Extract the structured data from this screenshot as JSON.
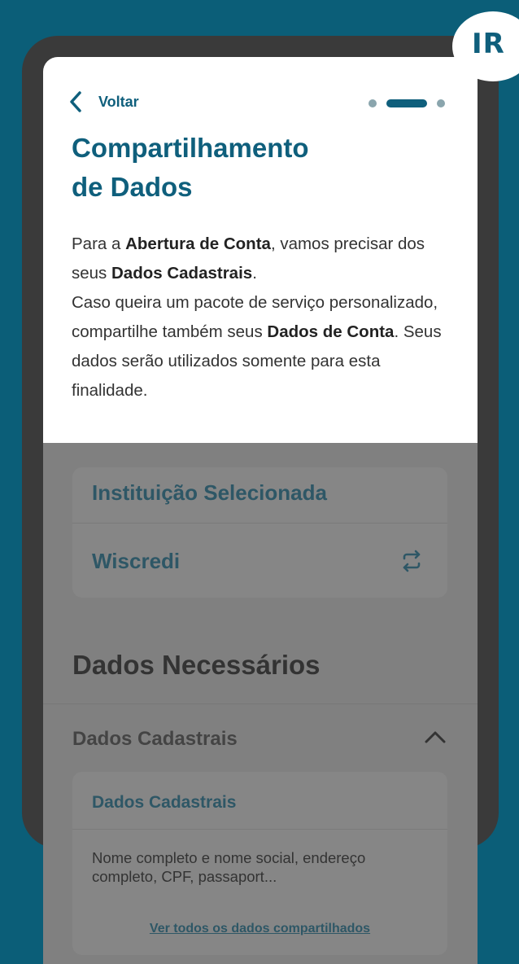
{
  "badge": {
    "label": "IR"
  },
  "header": {
    "back_label": "Voltar",
    "title_line1": "Compartilhamento",
    "title_line2": "de Dados"
  },
  "description": {
    "p1_a": "Para a ",
    "p1_b": "Abertura de Conta",
    "p1_c": ", vamos precisar dos seus ",
    "p1_d": "Dados Cadastrais",
    "p1_e": ".",
    "p2_a": "Caso queira um pacote de serviço personalizado, compartilhe também seus ",
    "p2_b": "Dados de Conta",
    "p2_c": ". Seus dados serão utilizados somente para esta finalidade."
  },
  "institution": {
    "title": "Instituição Selecionada",
    "name": "Wiscredi"
  },
  "required_data": {
    "section_title": "Dados Necessários",
    "accordion_label": "Dados Cadastrais",
    "card_title": "Dados Cadastrais",
    "card_desc": "Nome completo e nome social, endereço completo, CPF, passaport...",
    "card_link": "Ver todos os dados compartilhados"
  },
  "colors": {
    "background": "#0b5e78",
    "brand": "#0f5f7c",
    "overlay": "#808080"
  }
}
